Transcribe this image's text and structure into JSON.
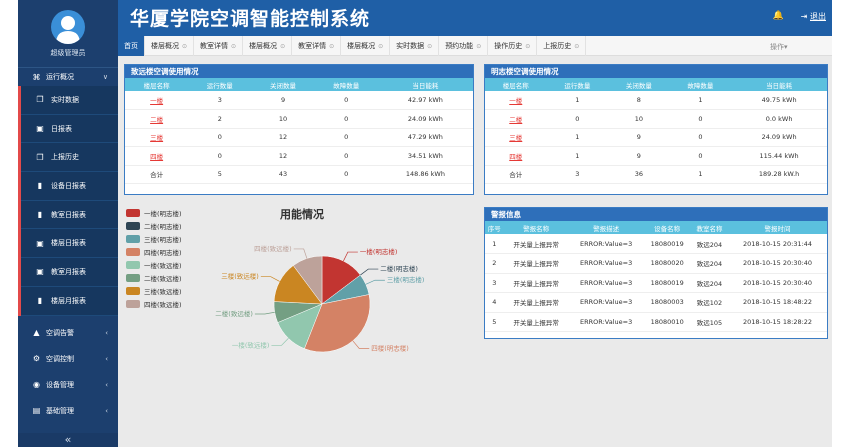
{
  "sidebar": {
    "user_name": "超级管理员",
    "menu_overview": "运行概况",
    "sub_items": [
      {
        "label": "实时数据",
        "icon": "copy-icon"
      },
      {
        "label": "日报表",
        "icon": "calendar-icon"
      },
      {
        "label": "上报历史",
        "icon": "copy-icon"
      },
      {
        "label": "设备日报表",
        "icon": "grid-icon"
      },
      {
        "label": "教室日报表",
        "icon": "grid-icon"
      },
      {
        "label": "楼层日报表",
        "icon": "calendar-icon"
      },
      {
        "label": "教室月报表",
        "icon": "calendar-icon"
      },
      {
        "label": "楼层月报表",
        "icon": "grid-icon"
      }
    ],
    "bottom_menus": [
      {
        "label": "空调告警",
        "icon": "warning-icon"
      },
      {
        "label": "空调控制",
        "icon": "gears-icon"
      },
      {
        "label": "设备管理",
        "icon": "globe-icon"
      },
      {
        "label": "基础管理",
        "icon": "book-icon"
      }
    ],
    "collapse": "«"
  },
  "header": {
    "title": "华厦学院空调智能控制系统",
    "logout": "退出"
  },
  "tabs": [
    "首页",
    "楼层概况",
    "教室详情",
    "楼层概况",
    "教室详情",
    "楼层概况",
    "实时数据",
    "预约功能",
    "操作历史",
    "上报历史"
  ],
  "tab_ops": "操作▾",
  "zhiyuan": {
    "title": "致远楼空调使用情况",
    "columns": [
      "楼层名称",
      "运行数量",
      "关闭数量",
      "故障数量",
      "当日能耗"
    ],
    "rows": [
      [
        "一楼",
        "3",
        "9",
        "0",
        "42.97 kWh"
      ],
      [
        "二楼",
        "2",
        "10",
        "0",
        "24.09 kWh"
      ],
      [
        "三楼",
        "0",
        "12",
        "0",
        "47.29 kWh"
      ],
      [
        "四楼",
        "0",
        "12",
        "0",
        "34.51 kWh"
      ],
      [
        "合计",
        "5",
        "43",
        "0",
        "148.86 kWh"
      ]
    ]
  },
  "mingzhi": {
    "title": "明志楼空调使用情况",
    "columns": [
      "楼层名称",
      "运行数量",
      "关闭数量",
      "故障数量",
      "当日能耗"
    ],
    "rows": [
      [
        "一楼",
        "1",
        "8",
        "1",
        "49.75 kWh"
      ],
      [
        "二楼",
        "0",
        "10",
        "0",
        "0.0 kWh"
      ],
      [
        "三楼",
        "1",
        "9",
        "0",
        "24.09 kWh"
      ],
      [
        "四楼",
        "1",
        "9",
        "0",
        "115.44 kWh"
      ],
      [
        "合计",
        "3",
        "36",
        "1",
        "189.28 kW.h"
      ]
    ]
  },
  "alarm": {
    "title": "警报信息",
    "columns": [
      "序号",
      "警报名称",
      "警报描述",
      "设备名称",
      "教室名称",
      "警报时间"
    ],
    "rows": [
      [
        "1",
        "开关量上报异常",
        "ERROR:Value=3",
        "18080019",
        "致远204",
        "2018-10-15 20:31:44"
      ],
      [
        "2",
        "开关量上报异常",
        "ERROR:Value=3",
        "18080020",
        "致远204",
        "2018-10-15 20:30:40"
      ],
      [
        "3",
        "开关量上报异常",
        "ERROR:Value=3",
        "18080019",
        "致远204",
        "2018-10-15 20:30:40"
      ],
      [
        "4",
        "开关量上报异常",
        "ERROR:Value=3",
        "18080003",
        "致远102",
        "2018-10-15 18:48:22"
      ],
      [
        "5",
        "开关量上报异常",
        "ERROR:Value=3",
        "18080010",
        "致远105",
        "2018-10-15 18:28:22"
      ]
    ]
  },
  "chart_data": {
    "type": "pie",
    "title": "用能情况",
    "series": [
      {
        "name": "一楼(明志楼)",
        "value": 49.75,
        "color": "#c23531"
      },
      {
        "name": "二楼(明志楼)",
        "value": 0.0,
        "color": "#2f4554"
      },
      {
        "name": "三楼(明志楼)",
        "value": 24.09,
        "color": "#61a0a8"
      },
      {
        "name": "四楼(明志楼)",
        "value": 115.44,
        "color": "#d48265"
      },
      {
        "name": "一楼(致远楼)",
        "value": 42.97,
        "color": "#91c7ae"
      },
      {
        "name": "二楼(致远楼)",
        "value": 24.09,
        "color": "#749f83"
      },
      {
        "name": "三楼(致远楼)",
        "value": 47.29,
        "color": "#ca8622"
      },
      {
        "name": "四楼(致远楼)",
        "value": 34.51,
        "color": "#bda29a"
      }
    ],
    "legend": "left"
  }
}
